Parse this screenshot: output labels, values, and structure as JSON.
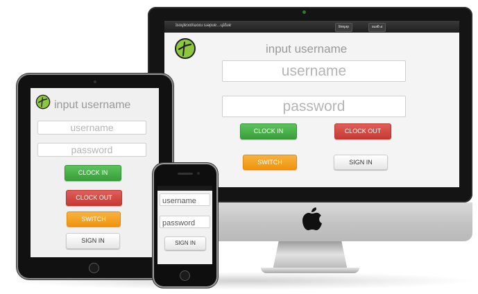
{
  "imac": {
    "topbar": {
      "url": "ʇsoɥlɐɔol/ɯooɹ sɹǝpuɐ…ɥʇ/ʇuɐ",
      "tab_left": "ʇlnɐɟǝp",
      "tab_right": "suǝƃ ꓒ"
    },
    "title": "input username",
    "username_placeholder": "username",
    "password_placeholder": "password",
    "clock_in_label": "CLOCK IN",
    "clock_out_label": "CLOCK OUT",
    "switch_label": "SWITCH",
    "sign_in_label": "SIGN IN"
  },
  "ipad": {
    "title": "input username",
    "username_placeholder": "username",
    "password_placeholder": "password",
    "clock_in_label": "CLOCK IN",
    "clock_out_label": "CLOCK OUT",
    "switch_label": "SWITCH",
    "sign_in_label": "SIGN IN"
  },
  "iphone": {
    "username_placeholder": "username",
    "password_placeholder": "password",
    "sign_in_label": "SIGN IN"
  },
  "colors": {
    "logo_green": "#8dc63f",
    "clock_in": "#4cae4c",
    "clock_out": "#d9534f",
    "switch": "#f0ad4e",
    "sign_in": "#f5f5f5",
    "title_gray": "#999999"
  },
  "icons": {
    "logo": "lime-circle-tick-logo",
    "apple": "apple-logo-icon"
  }
}
